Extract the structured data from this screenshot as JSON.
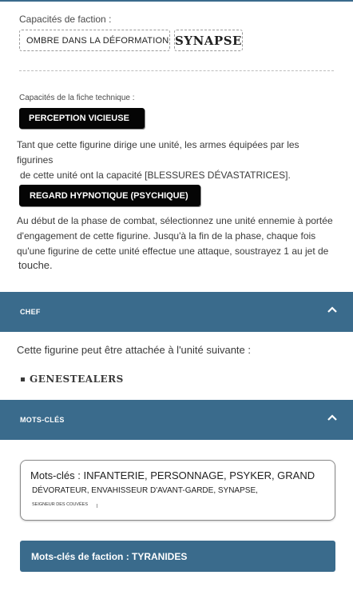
{
  "faction_abilities": {
    "label": "Capacités de faction :",
    "plain_ability": "OMBRE DANS LA DÉFORMATION",
    "keyword_ability": "SYNAPSE"
  },
  "datasheet_abilities": {
    "label": "Capacités de la fiche technique :",
    "abilities": [
      {
        "name": "PERCEPTION VICIEUSE",
        "description_lines": [
          "Tant que cette figurine dirige une unité, les armes équipées par les figurines",
          "de cette unité ont la capacité [BLESSURES DÉVASTATRICES]."
        ]
      },
      {
        "name": "REGARD HYPNOTIQUE (PSYCHIQUE)",
        "description_lines": [
          "Au début de la phase de combat, sélectionnez une unité ennemie à portée",
          "d'engagement de cette figurine. Jusqu'à la fin de la phase, chaque fois",
          "qu'une figurine de cette unité effectue une attaque, soustrayez 1 au jet de",
          "touche."
        ]
      }
    ]
  },
  "leader_section": {
    "title": "CHEF",
    "text": "Cette figurine peut être attachée à l'unité suivante :",
    "units": [
      "GENESTEALERS"
    ]
  },
  "keywords_section": {
    "title": "MOTS-CLÉS",
    "keywords_line1": "Mots-clés : INFANTERIE, PERSONNAGE, PSYKER, GRAND",
    "keywords_line2": "DÉVORATEUR, ENVAHISSEUR D'AVANT-GARDE, SYNAPSE,",
    "keywords_line3": "SEIGNEUR DES COUVÉES",
    "faction_keywords": "Mots-clés de faction : TYRANIDES"
  },
  "colors": {
    "accent": "#3a6b8c",
    "pill": "#050505",
    "text": "#3a3a3a"
  },
  "icons": {
    "section_toggle": "chevron-up-icon",
    "list_bullet": "square-bullet-icon"
  }
}
